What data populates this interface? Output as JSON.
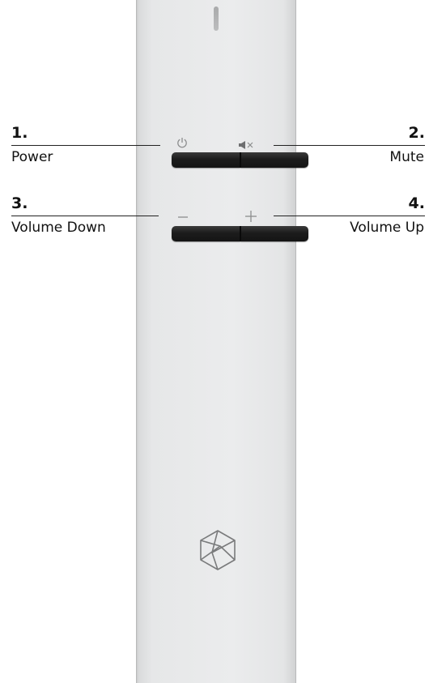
{
  "callouts": [
    {
      "number": "1.",
      "label": "Power"
    },
    {
      "number": "2.",
      "label": "Mute"
    },
    {
      "number": "3.",
      "label": "Volume Down"
    },
    {
      "number": "4.",
      "label": "Volume Up"
    }
  ],
  "icons": {
    "power": "power-icon",
    "mute": "speaker-mute-icon",
    "minus": "minus-icon",
    "plus": "plus-icon",
    "logo": "hexagon-logo-icon"
  },
  "colors": {
    "remote_body": "#e6e7e8",
    "buttons": "#1c1c1c",
    "icon_gray": "#8c8d8e",
    "text": "#111111"
  }
}
